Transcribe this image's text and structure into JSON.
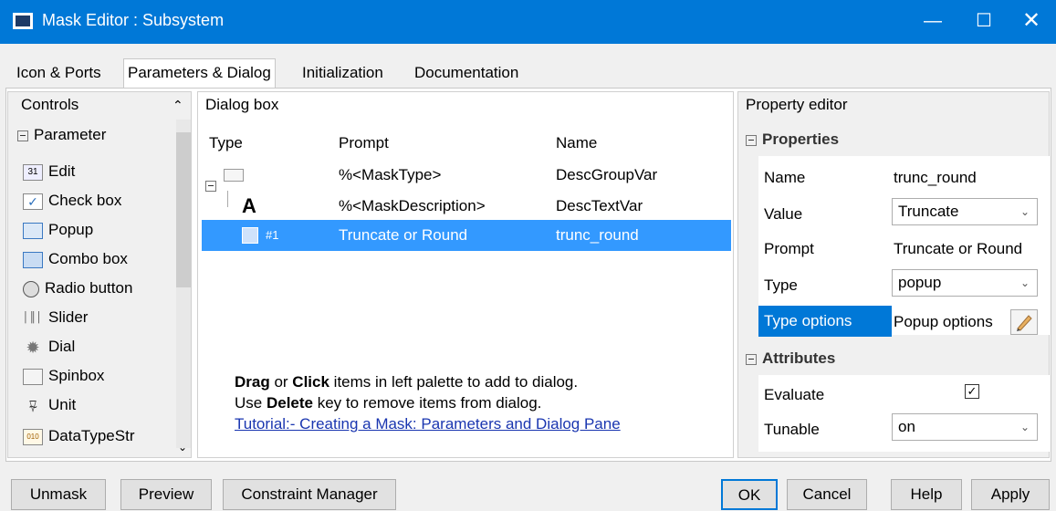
{
  "window": {
    "title": "Mask Editor : Subsystem"
  },
  "tabs": [
    "Icon & Ports",
    "Parameters & Dialog",
    "Initialization",
    "Documentation"
  ],
  "controls": {
    "header": "Controls",
    "group": "Parameter",
    "items": [
      "Edit",
      "Check box",
      "Popup",
      "Combo box",
      "Radio button",
      "Slider",
      "Dial",
      "Spinbox",
      "Unit",
      "DataTypeStr"
    ]
  },
  "dialog": {
    "header": "Dialog box",
    "columns": [
      "Type",
      "Prompt",
      "Name"
    ],
    "rows": [
      {
        "type": "",
        "prompt": "%<MaskType>",
        "name": "DescGroupVar"
      },
      {
        "type": "A",
        "prompt": "%<MaskDescription>",
        "name": "DescTextVar"
      },
      {
        "type": "#1",
        "prompt": "Truncate or Round",
        "name": "trunc_round"
      }
    ],
    "hint": {
      "drag": "Drag",
      "or": " or ",
      "click": "Click",
      "line1_rest": " items in left palette to add to dialog.",
      "use": "Use ",
      "delete": "Delete",
      "line2_rest": " key to remove items from dialog.",
      "tutorial": "Tutorial:- Creating a Mask: Parameters and Dialog Pane"
    }
  },
  "property_editor": {
    "header": "Property editor",
    "properties_section": "Properties",
    "name_label": "Name",
    "name_value": "trunc_round",
    "value_label": "Value",
    "value_value": "Truncate",
    "prompt_label": "Prompt",
    "prompt_value": "Truncate or Round",
    "type_label": "Type",
    "type_value": "popup",
    "typeoptions_label": "Type options",
    "typeoptions_value": "Popup options",
    "attributes_section": "Attributes",
    "evaluate_label": "Evaluate",
    "evaluate_checked": true,
    "tunable_label": "Tunable",
    "tunable_value": "on"
  },
  "buttons": {
    "unmask": "Unmask",
    "preview": "Preview",
    "constraint": "Constraint Manager",
    "ok": "OK",
    "cancel": "Cancel",
    "help": "Help",
    "apply": "Apply"
  },
  "colors": {
    "titlebar": "#0078d7",
    "selection": "#3399ff",
    "link": "#1a36b0"
  }
}
